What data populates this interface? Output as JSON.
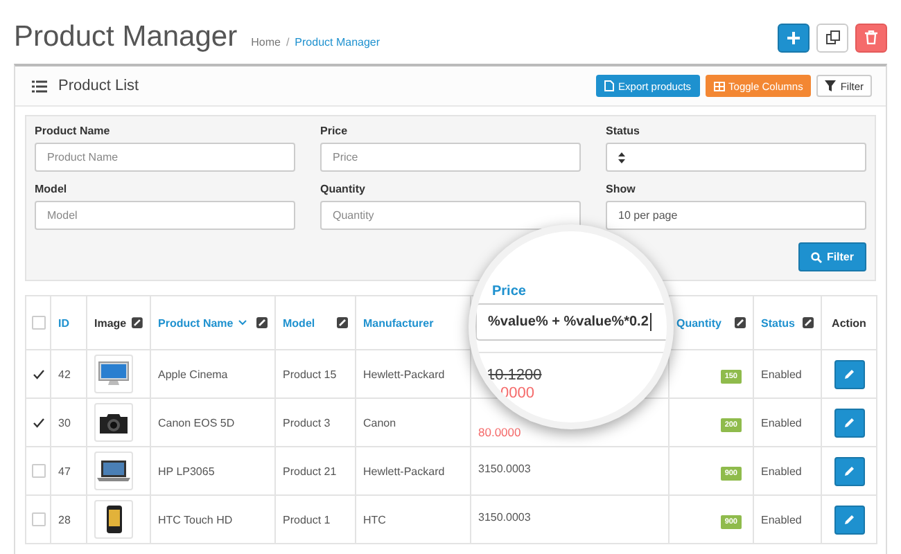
{
  "page": {
    "title": "Product Manager",
    "separator": "/",
    "breadcrumb": [
      {
        "label": "Home",
        "current": false
      },
      {
        "label": "Product Manager",
        "current": true
      }
    ]
  },
  "header_actions": [
    {
      "kind": "add"
    },
    {
      "kind": "copy"
    },
    {
      "kind": "delete"
    }
  ],
  "panel": {
    "title": "Product List",
    "buttons": [
      {
        "kind": "export",
        "label": "Export products"
      },
      {
        "kind": "toggle",
        "label": "Toggle Columns"
      },
      {
        "kind": "filter",
        "label": "Filter"
      }
    ]
  },
  "filter": {
    "fields": [
      {
        "label": "Product Name",
        "kind": "text",
        "placeholder": "Product Name"
      },
      {
        "label": "Price",
        "kind": "text",
        "placeholder": "Price"
      },
      {
        "label": "Status",
        "kind": "select"
      },
      {
        "label": "Model",
        "kind": "text",
        "placeholder": "Model"
      },
      {
        "label": "Quantity",
        "kind": "text",
        "placeholder": "Quantity"
      },
      {
        "label": "Show",
        "kind": "text",
        "value": "10 per page"
      }
    ],
    "button": "Filter"
  },
  "table": {
    "all_checked": false,
    "columns": [
      {
        "label": "ID",
        "sortable": true,
        "toggle": false,
        "sorted": false
      },
      {
        "label": "Image",
        "sortable": false,
        "toggle": true,
        "sorted": false
      },
      {
        "label": "Product Name",
        "sortable": true,
        "toggle": true,
        "sorted": true
      },
      {
        "label": "Model",
        "sortable": true,
        "toggle": true,
        "sorted": false
      },
      {
        "label": "Manufacturer",
        "sortable": true,
        "toggle": false,
        "sorted": false
      },
      {
        "label": "Quantity",
        "sortable": true,
        "toggle": true,
        "sorted": false
      },
      {
        "label": "Status",
        "sortable": true,
        "toggle": true,
        "sorted": false
      },
      {
        "label": "Action",
        "sortable": false,
        "toggle": false,
        "sorted": false
      }
    ],
    "rows": [
      {
        "checked": true,
        "id": "42",
        "kind": "monitor",
        "name": "Apple Cinema",
        "model": "Product 15",
        "manufacturer": "Hewlett-Packard",
        "quantity": "150",
        "status": "Enabled"
      },
      {
        "checked": true,
        "id": "30",
        "kind": "camera",
        "name": "Canon EOS 5D",
        "model": "Product 3",
        "manufacturer": "Canon",
        "special_price": "80.0000",
        "quantity": "200",
        "status": "Enabled"
      },
      {
        "checked": false,
        "id": "47",
        "kind": "laptop",
        "name": "HP LP3065",
        "model": "Product 21",
        "manufacturer": "Hewlett-Packard",
        "price": "3150.0003",
        "quantity": "900",
        "status": "Enabled"
      },
      {
        "checked": false,
        "id": "28",
        "kind": "phone",
        "name": "HTC Touch HD",
        "model": "Product 1",
        "manufacturer": "HTC",
        "price": "3150.0003",
        "quantity": "900",
        "status": "Enabled"
      }
    ]
  },
  "magnifier": {
    "heading": "Price",
    "input_value": "%value% + %value%*0.2",
    "old_price": "10.1200",
    "special_price": "0000"
  }
}
